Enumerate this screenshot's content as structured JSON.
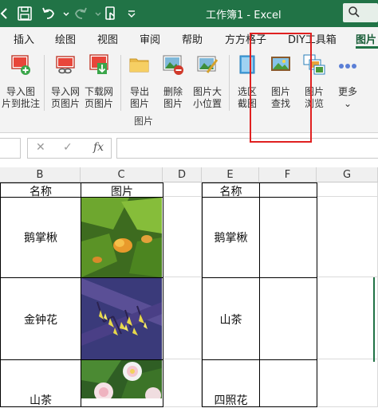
{
  "app": {
    "title": "工作簿1  -  Excel",
    "accent": "#217346"
  },
  "tabs": [
    "插入",
    "绘图",
    "视图",
    "审阅",
    "帮助",
    "方方格子",
    "DIY工具箱",
    "图片"
  ],
  "active_tab": "图片",
  "ribbon": {
    "group_label": "图片",
    "buttons": [
      {
        "label": "导入图\n片到批注",
        "icon": "import-to-comment-icon"
      },
      {
        "label": "导入网\n页图片",
        "icon": "import-web-image-icon"
      },
      {
        "label": "下载网\n页图片",
        "icon": "download-web-image-icon"
      },
      {
        "label": "导出\n图片",
        "icon": "export-image-folder-icon"
      },
      {
        "label": "删除\n图片",
        "icon": "delete-image-icon"
      },
      {
        "label": "图片大\n小位置",
        "icon": "image-size-position-icon"
      },
      {
        "label": "选区\n截图",
        "icon": "selection-screenshot-icon"
      },
      {
        "label": "图片\n查找",
        "icon": "image-find-icon"
      },
      {
        "label": "图片\n浏览",
        "icon": "image-browse-icon"
      },
      {
        "label": "更多\n⌄",
        "icon": "more-dots-icon"
      }
    ]
  },
  "formula_bar": {
    "cancel": "✕",
    "enter": "✓",
    "fx": "fx",
    "value": ""
  },
  "columns": [
    "B",
    "C",
    "D",
    "E",
    "F",
    "G"
  ],
  "table": {
    "header_b": "名称",
    "header_c": "图片",
    "header_e": "名称",
    "rows_b": [
      "鹅掌楸",
      "金钟花",
      "山茶"
    ],
    "rows_e": [
      "鹅掌楸",
      "山茶",
      "四照花"
    ]
  }
}
